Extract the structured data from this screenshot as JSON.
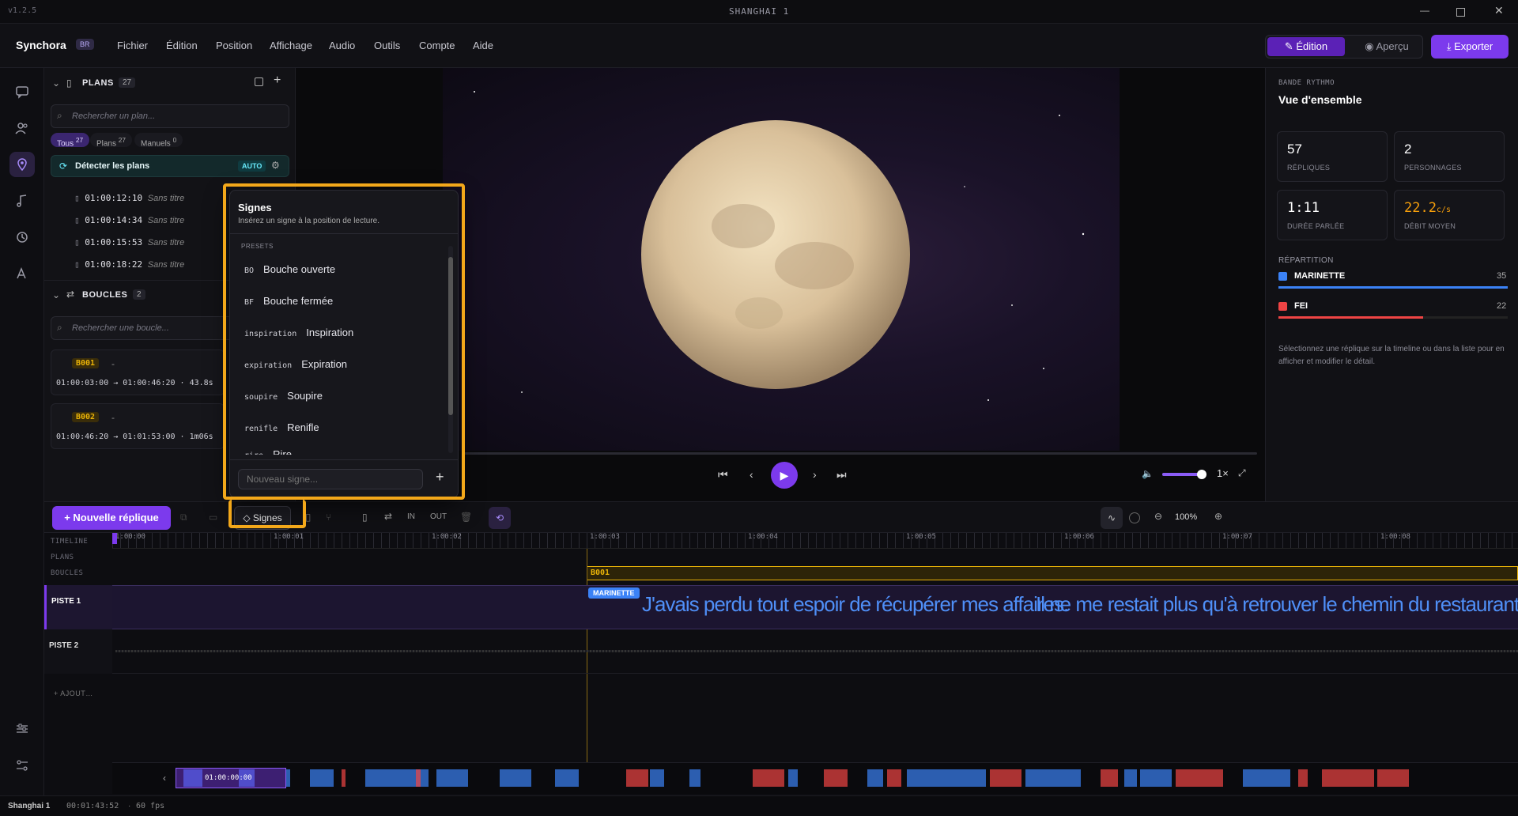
{
  "window": {
    "version": "v1.2.5",
    "title": "SHANGHAI 1"
  },
  "brand": {
    "name": "Synchora",
    "badge": "BR"
  },
  "menu": [
    "Fichier",
    "Édition",
    "Position",
    "Affichage",
    "Audio",
    "Outils",
    "Compte",
    "Aide"
  ],
  "modes": {
    "edit": "Édition",
    "preview": "Aperçu",
    "export": "Exporter"
  },
  "plans": {
    "title": "PLANS",
    "count": "27",
    "search_placeholder": "Rechercher un plan...",
    "filters": [
      {
        "label": "Tous",
        "count": "27"
      },
      {
        "label": "Plans",
        "count": "27"
      },
      {
        "label": "Manuels",
        "count": "0"
      }
    ],
    "detect": "Détecter les plans",
    "auto": "AUTO",
    "items": [
      {
        "tc": "01:00:12:10",
        "name": "Sans titre"
      },
      {
        "tc": "01:00:14:34",
        "name": "Sans titre"
      },
      {
        "tc": "01:00:15:53",
        "name": "Sans titre"
      },
      {
        "tc": "01:00:18:22",
        "name": "Sans titre"
      }
    ]
  },
  "loops": {
    "title": "BOUCLES",
    "count": "2",
    "search_placeholder": "Rechercher une boucle...",
    "items": [
      {
        "id": "B001",
        "dash": "-",
        "range": "01:00:03:00 → 01:00:46:20 · 43.8s"
      },
      {
        "id": "B002",
        "dash": "-",
        "range": "01:00:46:20 → 01:01:53:00 · 1m06s"
      }
    ]
  },
  "signs_popup": {
    "title": "Signes",
    "subtitle": "Insérez un signe à la position de lecture.",
    "section": "PRESETS",
    "presets": [
      {
        "code": "BO",
        "label": "Bouche ouverte"
      },
      {
        "code": "BF",
        "label": "Bouche fermée"
      },
      {
        "code": "inspiration",
        "label": "Inspiration"
      },
      {
        "code": "expiration",
        "label": "Expiration"
      },
      {
        "code": "soupire",
        "label": "Soupire"
      },
      {
        "code": "renifle",
        "label": "Renifle"
      },
      {
        "code": "rire",
        "label": "Rire"
      }
    ],
    "new_placeholder": "Nouveau signe...",
    "add": "+"
  },
  "player": {
    "speed": "1×",
    "volume": 0.9,
    "progress": 0.0
  },
  "right": {
    "section": "BANDE RYTHMO",
    "title": "Vue d'ensemble",
    "stats": [
      {
        "value": "57",
        "label": "RÉPLIQUES"
      },
      {
        "value": "2",
        "label": "PERSONNAGES"
      },
      {
        "value": "1:11",
        "label": "DURÉE PARLÉE"
      },
      {
        "value": "22.2",
        "unit": "c/s",
        "label": "DÉBIT MOYEN"
      }
    ],
    "repartition_title": "RÉPARTITION",
    "characters": [
      {
        "name": "MARINETTE",
        "count": "35",
        "color": "#3b82f6",
        "fraction": 1.0
      },
      {
        "name": "FEI",
        "count": "22",
        "color": "#ef4444",
        "fraction": 0.63
      }
    ],
    "hint": "Sélectionnez une réplique sur la timeline ou dans la liste pour en afficher et modifier le détail."
  },
  "toolbar": {
    "new_line": "Nouvelle réplique",
    "signs": "Signes",
    "in": "IN",
    "out": "OUT",
    "zoom": "100%"
  },
  "timeline": {
    "row_labels": [
      "TIMELINE",
      "PLANS",
      "BOUCLES"
    ],
    "ticks": [
      "1:00:00",
      "1:00:01",
      "1:00:02",
      "1:00:03",
      "1:00:04",
      "1:00:05",
      "1:00:06",
      "1:00:07",
      "1:00:08"
    ],
    "loop_label": "B001",
    "tracks": [
      "PISTE 1",
      "PISTE 2"
    ],
    "add_track": "AJOUT…",
    "line_character": "MARINETTE",
    "lines": [
      "J'avais perdu tout espoir de récupérer mes affaires.",
      "Il ne me restait plus qu'à retrouver le chemin du restaurant"
    ],
    "mini_timecode": "01:00:00:00"
  },
  "status": {
    "project": "Shanghai 1",
    "duration": "00:01:43:52",
    "fps": "60 fps",
    "sep": "·"
  },
  "colors": {
    "accent": "#7c3aed",
    "marinette": "#3b82f6",
    "fei": "#ef4444",
    "highlight": "#f3a81a",
    "loop": "#eab308"
  }
}
